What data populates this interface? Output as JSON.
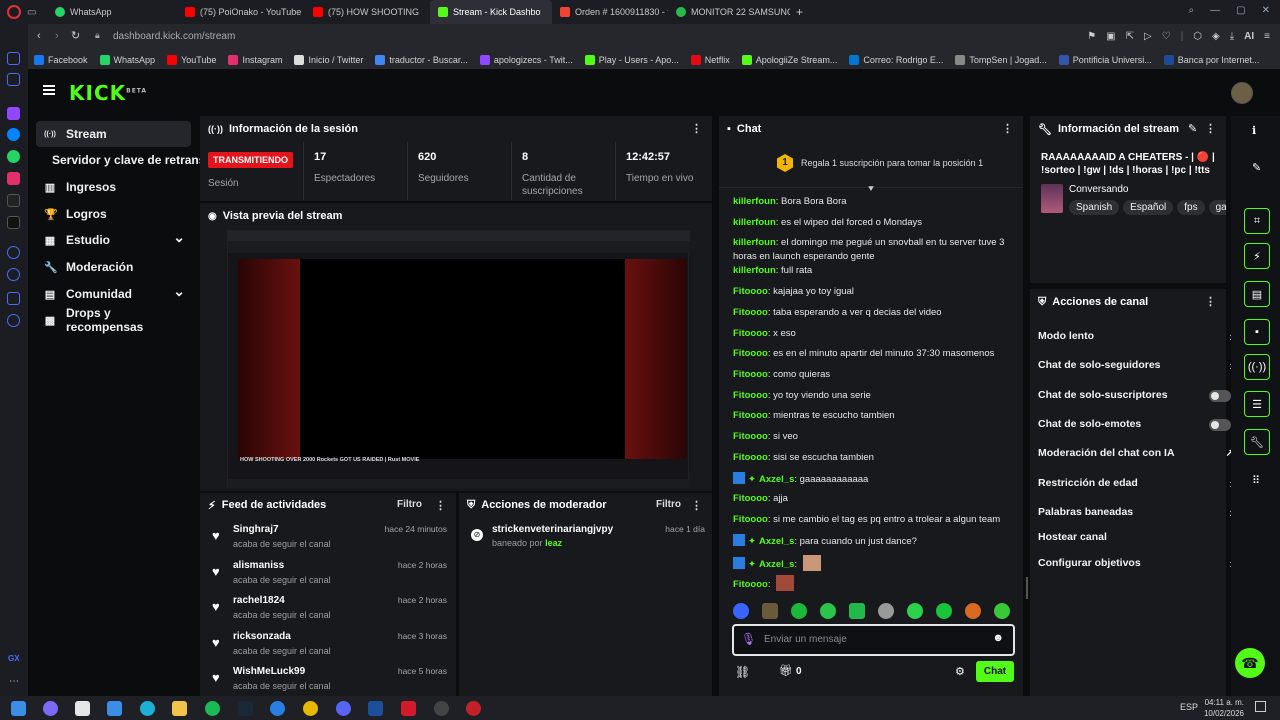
{
  "browser": {
    "tabs": [
      {
        "label": "WhatsApp",
        "color": "#25d366"
      },
      {
        "label": "(75) PoiOnako - YouTube",
        "color": "#ff0000"
      },
      {
        "label": "(75) HOW SHOOTING",
        "color": "#ff0000"
      },
      {
        "label": "Stream - Kick Dashbo",
        "color": "#53fc18"
      },
      {
        "label": "Orden # 1600911830 - tie",
        "color": "#e43"
      },
      {
        "label": "MONITOR 22 SAMSUNG E",
        "color": "#2bba4a"
      }
    ],
    "new_tab": "+",
    "url": "dashboard.kick.com/stream",
    "ai_label": "AI",
    "bookmarks": [
      {
        "label": "Facebook",
        "color": "#1877f2"
      },
      {
        "label": "WhatsApp",
        "color": "#25d366"
      },
      {
        "label": "YouTube",
        "color": "#ff0000"
      },
      {
        "label": "Instagram",
        "color": "#e1306c"
      },
      {
        "label": "Inicio / Twitter",
        "color": "#dddddd"
      },
      {
        "label": "traductor - Buscar...",
        "color": "#4285f4"
      },
      {
        "label": "apologizecs - Twit...",
        "color": "#9146ff"
      },
      {
        "label": "Play - Users - Apo...",
        "color": "#53fc18"
      },
      {
        "label": "Netflix",
        "color": "#e50914"
      },
      {
        "label": "ApologiiZe Stream...",
        "color": "#53fc18"
      },
      {
        "label": "Correo: Rodrigo E...",
        "color": "#0078d4"
      },
      {
        "label": "TompSen | Jogad...",
        "color": "#888888"
      },
      {
        "label": "Pontificia Universi...",
        "color": "#3355aa"
      },
      {
        "label": "Banca por Internet...",
        "color": "#1e4b9c"
      }
    ]
  },
  "kick": {
    "logo": "KICK",
    "logo_beta": "BETA",
    "nav": [
      {
        "label": "Stream",
        "icon": "((·))"
      },
      {
        "label": "Servidor y clave de retransm",
        "icon": ""
      },
      {
        "label": "Ingresos",
        "icon": "▥"
      },
      {
        "label": "Logros",
        "icon": "🏆"
      },
      {
        "label": "Estudio",
        "icon": "▦"
      },
      {
        "label": "Moderación",
        "icon": "🔧"
      },
      {
        "label": "Comunidad",
        "icon": "▤"
      },
      {
        "label": "Drops y recompensas",
        "icon": "▩"
      }
    ],
    "session": {
      "title": "Información de la sesión",
      "status_badge": "TRANSMITIENDO",
      "status_label": "Sesión",
      "stats": [
        {
          "value": "17",
          "label": "Espectadores"
        },
        {
          "value": "620",
          "label": "Seguidores"
        },
        {
          "value": "8",
          "label": "Cantidad de suscripciones"
        },
        {
          "value": "12:42:57",
          "label": "Tiempo en vivo"
        }
      ]
    },
    "preview": {
      "title": "Vista previa del stream",
      "video_title": "HOW SHOOTING OVER 2000 Rockets GOT US RAIDED | Rust MOVIE"
    },
    "feed": {
      "title": "Feed de actividades",
      "filter": "Filtro",
      "items": [
        {
          "name": "Singhraj7",
          "sub": "acaba de seguir el canal",
          "time": "hace 24 minutos"
        },
        {
          "name": "alismaniss",
          "sub": "acaba de seguir el canal",
          "time": "hace 2 horas"
        },
        {
          "name": "rachel1824",
          "sub": "acaba de seguir el canal",
          "time": "hace 2 horas"
        },
        {
          "name": "ricksonzada",
          "sub": "acaba de seguir el canal",
          "time": "hace 3 horas"
        },
        {
          "name": "WishMeLuck99",
          "sub": "acaba de seguir el canal",
          "time": "hace 5 horas"
        }
      ]
    },
    "modactions": {
      "title": "Acciones de moderador",
      "filter": "Filtro",
      "items": [
        {
          "name": "strickenveterinariangjvpy",
          "sub_prefix": "baneado por",
          "by": "leaz",
          "time": "hace 1 día"
        }
      ]
    },
    "chat": {
      "title": "Chat",
      "gift_rank": "1",
      "gift_text": "Regala 1 suscripción para tomar la posición 1",
      "messages": [
        {
          "user": "killerfoun",
          "text": "Bora Bora Bora"
        },
        {
          "user": "killerfoun",
          "text": "es el wipeo del forced o Mondays"
        },
        {
          "user": "killerfoun",
          "text": "el domingo me pegué un snovball en tu server tuve 3 horas en launch esperando gente"
        },
        {
          "user": "killerfoun",
          "text": "full rata"
        },
        {
          "user": "Fitoooo",
          "text": "kajajaa yo toy igual"
        },
        {
          "user": "Fitoooo",
          "text": "taba esperando a ver q decias del video"
        },
        {
          "user": "Fitoooo",
          "text": "x eso"
        },
        {
          "user": "Fitoooo",
          "text": "es en el minuto apartir del minuto 37:30 masomenos"
        },
        {
          "user": "Fitoooo",
          "text": "como quieras"
        },
        {
          "user": "Fitoooo",
          "text": "yo toy viendo una serie"
        },
        {
          "user": "Fitoooo",
          "text": "mientras te escucho tambien"
        },
        {
          "user": "Fitoooo",
          "text": "si veo"
        },
        {
          "user": "Fitoooo",
          "text": "sisi se escucha tambien"
        },
        {
          "user": "Axzel_s",
          "text": "gaaaaaaaaaaaa"
        },
        {
          "user": "Fitoooo",
          "text": "ajja"
        },
        {
          "user": "Fitoooo",
          "text": "si me cambio el tag es pq entro a trolear a algun team"
        },
        {
          "user": "Axzel_s",
          "text": "para cuando un just dance?"
        },
        {
          "user": "Axzel_s",
          "text": ""
        },
        {
          "user": "Fitoooo",
          "text": ""
        }
      ],
      "input_placeholder": "Enviar un mensaje",
      "points": "0",
      "send_label": "Chat"
    },
    "stream_info": {
      "title": "Información del stream",
      "stream_title": "RAAAAAAAAID A CHEATERS - | 🔴 | !sorteo | !gw | !ds | !horas | !pc | !tts",
      "category": "Conversando",
      "tags": [
        "Spanish",
        "Español",
        "fps",
        "gam"
      ]
    },
    "channel_actions": {
      "title": "Acciones de canal",
      "items": [
        {
          "label": "Modo lento",
          "control": "arrow"
        },
        {
          "label": "Chat de solo-seguidores",
          "control": "arrow"
        },
        {
          "label": "Chat de solo-suscriptores",
          "control": "toggle"
        },
        {
          "label": "Chat de solo-emotes",
          "control": "toggle"
        },
        {
          "label": "Moderación del chat con IA",
          "control": "external"
        },
        {
          "label": "Restricción de edad",
          "control": "arrow"
        },
        {
          "label": "Palabras baneadas",
          "control": "arrow"
        },
        {
          "label": "Hostear canal",
          "control": "none"
        },
        {
          "label": "Configurar objetivos",
          "control": "arrow"
        }
      ]
    }
  },
  "taskbar": {
    "lang": "ESP",
    "time": "04:11 a. m.",
    "date": "10/02/2026"
  },
  "colors": {
    "accent": "#53fc18",
    "live": "#e5131c",
    "bg": "#0b0c0e",
    "panel": "#18191d"
  }
}
